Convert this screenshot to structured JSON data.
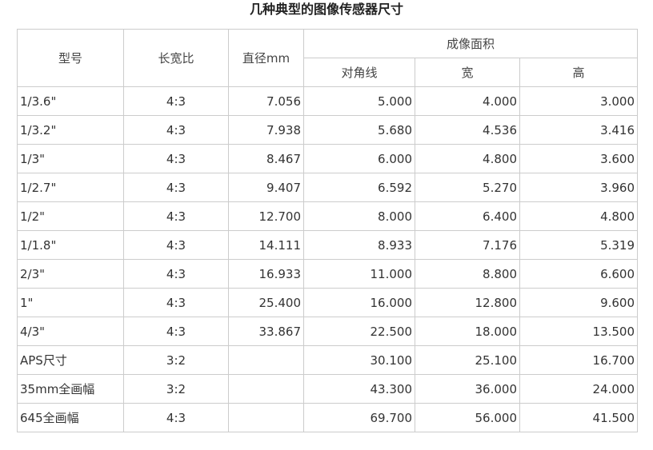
{
  "title": "几种典型的图像传感器尺寸",
  "table": {
    "headers": {
      "model": "型号",
      "aspect_ratio": "长宽比",
      "diameter": "直径mm",
      "imaging_area": "成像面积",
      "diagonal": "对角线",
      "width": "宽",
      "height": "高"
    },
    "rows": [
      {
        "model": "1/3.6\"",
        "ratio": "4:3",
        "diameter": "7.056",
        "diagonal": "5.000",
        "width": "4.000",
        "height": "3.000"
      },
      {
        "model": "1/3.2\"",
        "ratio": "4:3",
        "diameter": "7.938",
        "diagonal": "5.680",
        "width": "4.536",
        "height": "3.416"
      },
      {
        "model": "1/3\"",
        "ratio": "4:3",
        "diameter": "8.467",
        "diagonal": "6.000",
        "width": "4.800",
        "height": "3.600"
      },
      {
        "model": "1/2.7\"",
        "ratio": "4:3",
        "diameter": "9.407",
        "diagonal": "6.592",
        "width": "5.270",
        "height": "3.960"
      },
      {
        "model": "1/2\"",
        "ratio": "4:3",
        "diameter": "12.700",
        "diagonal": "8.000",
        "width": "6.400",
        "height": "4.800"
      },
      {
        "model": "1/1.8\"",
        "ratio": "4:3",
        "diameter": "14.111",
        "diagonal": "8.933",
        "width": "7.176",
        "height": "5.319"
      },
      {
        "model": "2/3\"",
        "ratio": "4:3",
        "diameter": "16.933",
        "diagonal": "11.000",
        "width": "8.800",
        "height": "6.600"
      },
      {
        "model": "1\"",
        "ratio": "4:3",
        "diameter": "25.400",
        "diagonal": "16.000",
        "width": "12.800",
        "height": "9.600"
      },
      {
        "model": "4/3\"",
        "ratio": "4:3",
        "diameter": "33.867",
        "diagonal": "22.500",
        "width": "18.000",
        "height": "13.500"
      },
      {
        "model": "APS尺寸",
        "ratio": "3:2",
        "diameter": "",
        "diagonal": "30.100",
        "width": "25.100",
        "height": "16.700"
      },
      {
        "model": "35mm全画幅",
        "ratio": "3:2",
        "diameter": "",
        "diagonal": "43.300",
        "width": "36.000",
        "height": "24.000"
      },
      {
        "model": "645全画幅",
        "ratio": "4:3",
        "diameter": "",
        "diagonal": "69.700",
        "width": "56.000",
        "height": "41.500"
      }
    ]
  }
}
